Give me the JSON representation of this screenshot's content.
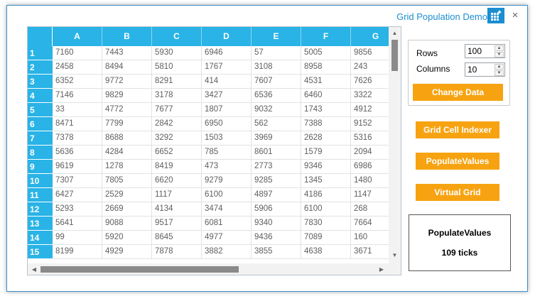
{
  "window": {
    "title": "Grid Population Demo",
    "close_glyph": "×",
    "app_icon": "grid-sparkle-icon"
  },
  "grid": {
    "columns": [
      "A",
      "B",
      "C",
      "D",
      "E",
      "F",
      "G"
    ],
    "rows": [
      {
        "header": "1",
        "cells": [
          "7160",
          "7443",
          "5930",
          "6946",
          "57",
          "5005",
          "9856"
        ]
      },
      {
        "header": "2",
        "cells": [
          "2458",
          "8494",
          "5810",
          "1767",
          "3108",
          "8958",
          "243"
        ]
      },
      {
        "header": "3",
        "cells": [
          "6352",
          "9772",
          "8291",
          "414",
          "7607",
          "4531",
          "7626"
        ]
      },
      {
        "header": "4",
        "cells": [
          "7146",
          "9829",
          "3178",
          "3427",
          "6536",
          "6460",
          "3322"
        ]
      },
      {
        "header": "5",
        "cells": [
          "33",
          "4772",
          "7677",
          "1807",
          "9032",
          "1743",
          "4912"
        ]
      },
      {
        "header": "6",
        "cells": [
          "8471",
          "7799",
          "2842",
          "6950",
          "562",
          "7388",
          "9152"
        ]
      },
      {
        "header": "7",
        "cells": [
          "7378",
          "8688",
          "3292",
          "1503",
          "3969",
          "2628",
          "5316"
        ]
      },
      {
        "header": "8",
        "cells": [
          "5636",
          "4284",
          "6652",
          "785",
          "8601",
          "1579",
          "2094"
        ]
      },
      {
        "header": "9",
        "cells": [
          "9619",
          "1278",
          "8419",
          "473",
          "2773",
          "9346",
          "6986"
        ]
      },
      {
        "header": "10",
        "cells": [
          "7307",
          "7805",
          "6620",
          "9279",
          "9285",
          "1345",
          "1480"
        ]
      },
      {
        "header": "11",
        "cells": [
          "6427",
          "2529",
          "1117",
          "6100",
          "4897",
          "4186",
          "1147"
        ]
      },
      {
        "header": "12",
        "cells": [
          "5293",
          "2669",
          "4134",
          "3474",
          "5906",
          "6100",
          "268"
        ]
      },
      {
        "header": "13",
        "cells": [
          "5641",
          "9088",
          "9517",
          "6081",
          "9340",
          "7830",
          "7664"
        ]
      },
      {
        "header": "14",
        "cells": [
          "99",
          "5920",
          "8645",
          "4977",
          "9436",
          "7089",
          "160"
        ]
      },
      {
        "header": "15",
        "cells": [
          "8199",
          "4929",
          "7878",
          "3882",
          "3855",
          "4638",
          "3671"
        ]
      }
    ]
  },
  "settings": {
    "rows_label": "Rows",
    "rows_value": "100",
    "columns_label": "Columns",
    "columns_value": "10",
    "change_data_label": "Change Data"
  },
  "actions": {
    "grid_cell_indexer_label": "Grid Cell Indexer",
    "populate_values_label": "PopulateValues",
    "virtual_grid_label": "Virtual Grid"
  },
  "result": {
    "method": "PopulateValues",
    "ticks": "109 ticks"
  },
  "colors": {
    "header_blue": "#29b3e6",
    "accent_orange": "#f7a311",
    "title_blue": "#1b8ed0"
  }
}
